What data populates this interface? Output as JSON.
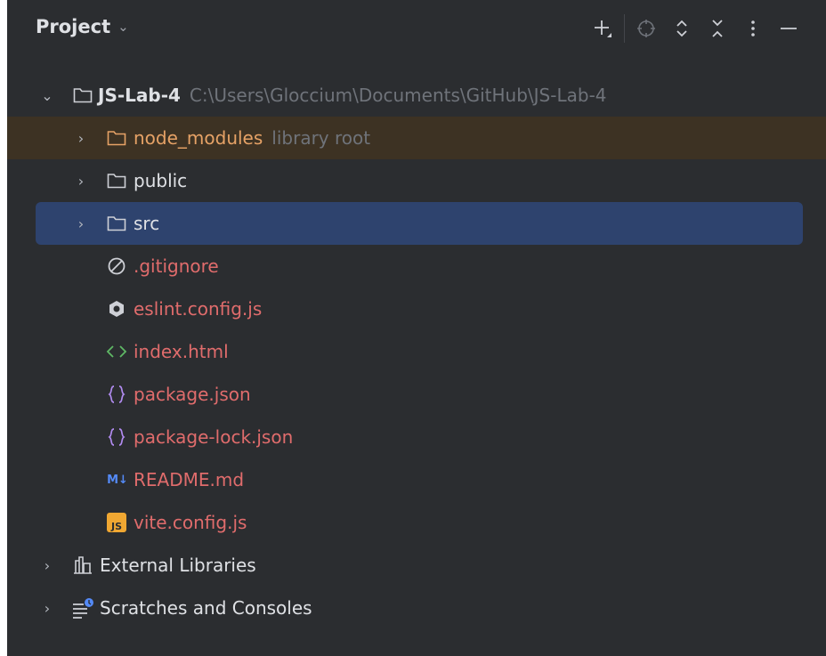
{
  "header": {
    "title": "Project",
    "toolbar": {
      "new_icon": "plus-icon",
      "locate_icon": "locate-icon",
      "expand_icon": "expand-all-icon",
      "collapse_icon": "collapse-all-icon",
      "options_icon": "more-vertical-icon",
      "hide_icon": "minimize-icon"
    }
  },
  "tree": {
    "root": {
      "name": "JS-Lab-4",
      "path": "C:\\Users\\Gloccium\\Documents\\GitHub\\JS-Lab-4"
    },
    "folders": [
      {
        "name": "node_modules",
        "hint": "library root"
      },
      {
        "name": "public"
      },
      {
        "name": "src"
      }
    ],
    "files": [
      {
        "name": ".gitignore",
        "icon": "ignore-file-icon"
      },
      {
        "name": "eslint.config.js",
        "icon": "eslint-icon"
      },
      {
        "name": "index.html",
        "icon": "html-icon"
      },
      {
        "name": "package.json",
        "icon": "json-icon"
      },
      {
        "name": "package-lock.json",
        "icon": "json-icon"
      },
      {
        "name": "README.md",
        "icon": "markdown-icon",
        "icon_text": "M↓"
      },
      {
        "name": "vite.config.js",
        "icon": "javascript-icon",
        "icon_text": "JS"
      }
    ],
    "external_libraries": "External Libraries",
    "scratches": "Scratches and Consoles"
  },
  "colors": {
    "panel_bg": "#2b2d30",
    "selected_bg": "#2e436e",
    "library_bg": "#3d3223",
    "modified_file": "#e06c6c",
    "added_file": "#5fb865",
    "library_folder": "#e6a266"
  }
}
